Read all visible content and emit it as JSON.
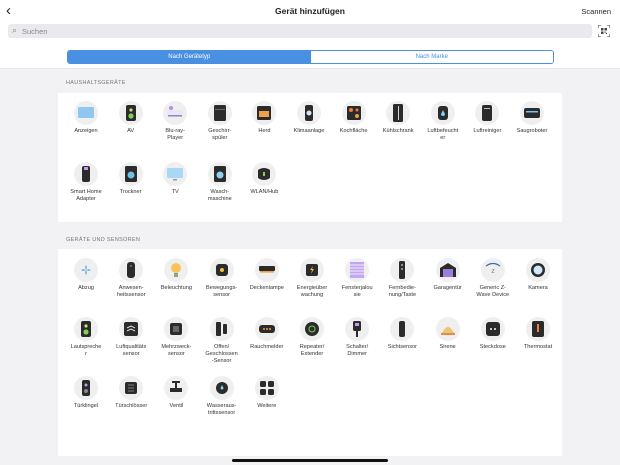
{
  "header": {
    "title": "Gerät hinzufügen",
    "scan_label": "Scannen",
    "back_icon": "chevron-left-icon"
  },
  "search": {
    "placeholder": "Suchen",
    "value": ""
  },
  "segments": [
    {
      "label": "Nach Gerätetyp",
      "active": true
    },
    {
      "label": "Nach Marke",
      "active": false
    }
  ],
  "sections": [
    {
      "title": "HAUSHALTSGERÄTE",
      "items": [
        {
          "label": "Anzeigen",
          "icon": "display-icon"
        },
        {
          "label": "AV",
          "icon": "speaker-icon"
        },
        {
          "label": "Blu-ray-\nPlayer",
          "icon": "bluray-icon"
        },
        {
          "label": "Geschirr-\nspüler",
          "icon": "dishwasher-icon"
        },
        {
          "label": "Herd",
          "icon": "oven-icon"
        },
        {
          "label": "Klimaanlage",
          "icon": "air-conditioner-icon"
        },
        {
          "label": "Kochfläche",
          "icon": "cooktop-icon"
        },
        {
          "label": "Kühlschrank",
          "icon": "fridge-icon"
        },
        {
          "label": "Luftbefeucht\ner",
          "icon": "humidifier-icon"
        },
        {
          "label": "Luftreiniger",
          "icon": "air-purifier-icon"
        },
        {
          "label": "Saugroboter",
          "icon": "robot-vacuum-icon"
        },
        {
          "label": "Smart Home\nAdapter",
          "icon": "smart-plug-adapter-icon"
        },
        {
          "label": "Trockner",
          "icon": "dryer-icon"
        },
        {
          "label": "TV",
          "icon": "tv-icon"
        },
        {
          "label": "Wasch-\nmaschine",
          "icon": "washing-machine-icon"
        },
        {
          "label": "WLAN/Hub",
          "icon": "hub-icon"
        }
      ]
    },
    {
      "title": "GERÄTE UND SENSOREN",
      "items": [
        {
          "label": "Abzug",
          "icon": "fan-icon"
        },
        {
          "label": "Anwesen-\nheitssensor",
          "icon": "presence-sensor-icon"
        },
        {
          "label": "Beleuchtung",
          "icon": "bulb-icon"
        },
        {
          "label": "Bewegungs-\nsensor",
          "icon": "motion-sensor-icon"
        },
        {
          "label": "Deckenlampe",
          "icon": "ceiling-lamp-icon"
        },
        {
          "label": "Energieüber\nwachung",
          "icon": "energy-monitor-icon"
        },
        {
          "label": "Fensterjalou\nsie",
          "icon": "blinds-icon"
        },
        {
          "label": "Fernbedie-\nnung/Taste",
          "icon": "remote-icon"
        },
        {
          "label": "Garagentür",
          "icon": "garage-door-icon"
        },
        {
          "label": "Generic Z-\nWave Device",
          "icon": "zwave-icon"
        },
        {
          "label": "Kamera",
          "icon": "camera-icon"
        },
        {
          "label": "Lautspreche\nr",
          "icon": "speaker-icon"
        },
        {
          "label": "Luftqualitäts\nsensor",
          "icon": "air-quality-icon"
        },
        {
          "label": "Mehrzweck-\nsensor",
          "icon": "multipurpose-sensor-icon"
        },
        {
          "label": "Offen/\nGeschlossen\n-Sensor",
          "icon": "contact-sensor-icon"
        },
        {
          "label": "Rauchmelder",
          "icon": "smoke-detector-icon"
        },
        {
          "label": "Repeater/\nExtender",
          "icon": "repeater-icon"
        },
        {
          "label": "Schalter/\nDimmer",
          "icon": "switch-icon"
        },
        {
          "label": "Sichtsensor",
          "icon": "vision-sensor-icon"
        },
        {
          "label": "Sirene",
          "icon": "siren-icon"
        },
        {
          "label": "Steckdose",
          "icon": "outlet-icon"
        },
        {
          "label": "Thermostat",
          "icon": "thermostat-icon"
        },
        {
          "label": "Türklingel",
          "icon": "doorbell-icon"
        },
        {
          "label": "Türschlösser",
          "icon": "door-lock-icon"
        },
        {
          "label": "Ventil",
          "icon": "valve-icon"
        },
        {
          "label": "Wasseraus-\ntrittssensor",
          "icon": "water-leak-icon"
        },
        {
          "label": "Weitere",
          "icon": "more-icon"
        }
      ]
    }
  ],
  "colors": {
    "accent": "#4a90e2",
    "background": "#f2f2f5",
    "tile_circle": "#efefef",
    "dark": "#2b2b2b"
  }
}
